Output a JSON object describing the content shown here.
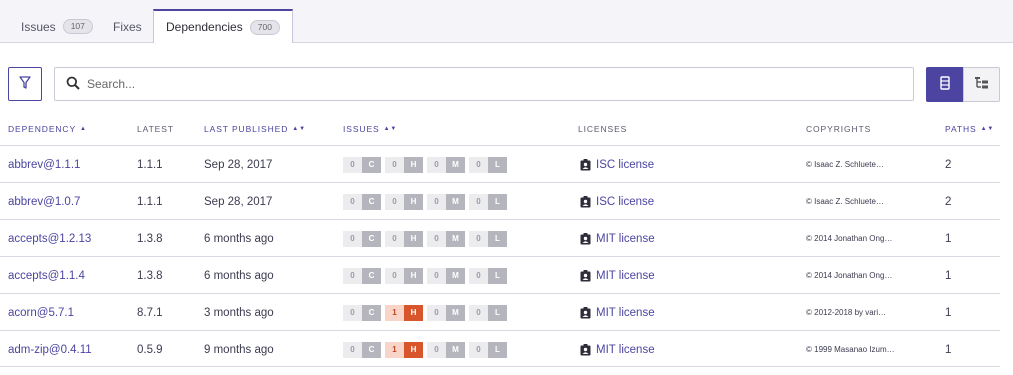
{
  "tabs": [
    {
      "label": "Issues",
      "count": "107"
    },
    {
      "label": "Fixes",
      "count": ""
    },
    {
      "label": "Dependencies",
      "count": "700"
    }
  ],
  "search": {
    "placeholder": "Search..."
  },
  "table": {
    "headers": {
      "dependency": "DEPENDENCY",
      "latest": "LATEST",
      "last_published": "LAST PUBLISHED",
      "issues": "ISSUES",
      "licenses": "LICENSES",
      "copyrights": "COPYRIGHTS",
      "paths": "PATHS"
    },
    "rows": [
      {
        "dependency": "abbrev@1.1.1",
        "latest": "1.1.1",
        "published": "Sep 28, 2017",
        "c": "0",
        "h": "0",
        "m": "0",
        "l": "0",
        "license": "ISC license",
        "copyright": "© Isaac Z. Schluete…",
        "paths": "2"
      },
      {
        "dependency": "abbrev@1.0.7",
        "latest": "1.1.1",
        "published": "Sep 28, 2017",
        "c": "0",
        "h": "0",
        "m": "0",
        "l": "0",
        "license": "ISC license",
        "copyright": "© Isaac Z. Schluete…",
        "paths": "2"
      },
      {
        "dependency": "accepts@1.2.13",
        "latest": "1.3.8",
        "published": "6 months ago",
        "c": "0",
        "h": "0",
        "m": "0",
        "l": "0",
        "license": "MIT license",
        "copyright": "© 2014 Jonathan Ong…",
        "paths": "1"
      },
      {
        "dependency": "accepts@1.1.4",
        "latest": "1.3.8",
        "published": "6 months ago",
        "c": "0",
        "h": "0",
        "m": "0",
        "l": "0",
        "license": "MIT license",
        "copyright": "© 2014 Jonathan Ong…",
        "paths": "1"
      },
      {
        "dependency": "acorn@5.7.1",
        "latest": "8.7.1",
        "published": "3 months ago",
        "c": "0",
        "h": "1",
        "m": "0",
        "l": "0",
        "license": "MIT license",
        "copyright": "© 2012-2018 by vari…",
        "paths": "1"
      },
      {
        "dependency": "adm-zip@0.4.11",
        "latest": "0.5.9",
        "published": "9 months ago",
        "c": "0",
        "h": "1",
        "m": "0",
        "l": "0",
        "license": "MIT license",
        "copyright": "© 1999 Masanao Izum…",
        "paths": "1"
      }
    ],
    "severity_labels": {
      "c": "C",
      "h": "H",
      "m": "M",
      "l": "L"
    }
  },
  "colors": {
    "accent": "#4b45a1",
    "high": "#d9562c",
    "high_light": "#f9d4c8",
    "neutral": "#b5b5bd"
  }
}
